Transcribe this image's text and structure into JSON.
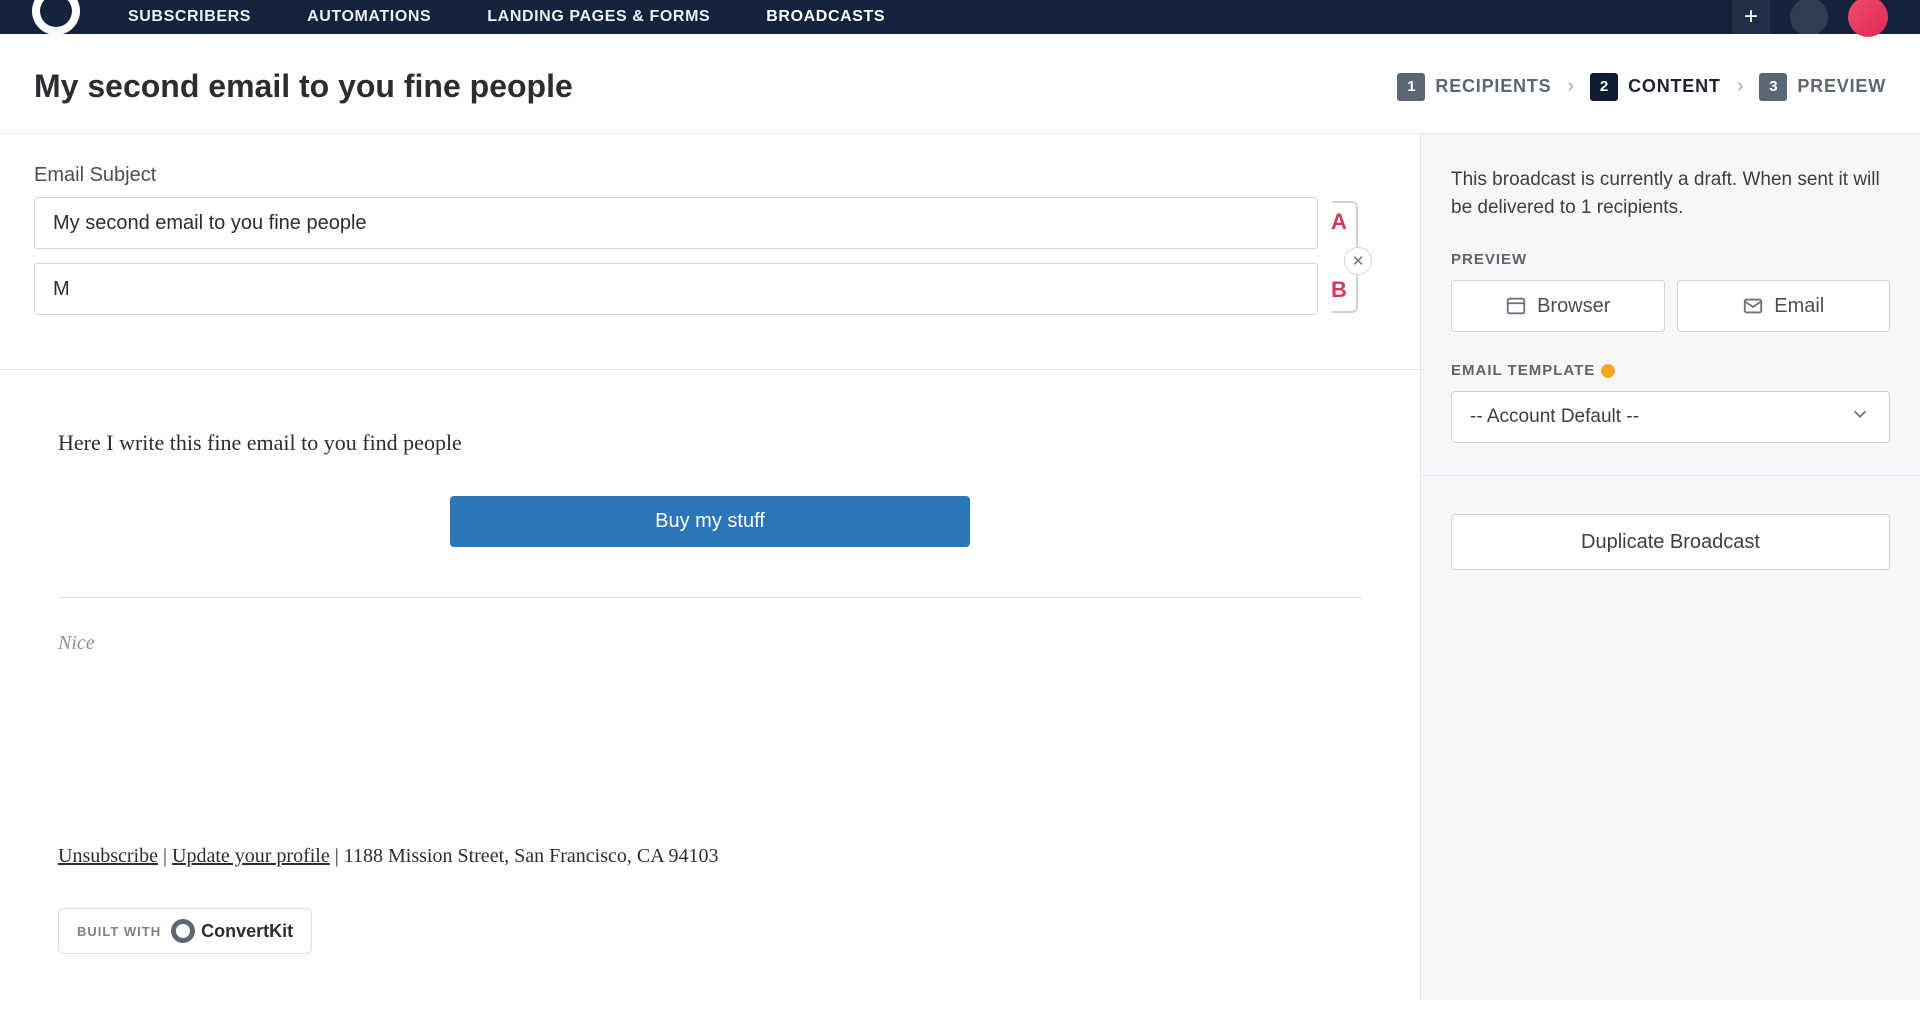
{
  "nav": {
    "links": [
      "SUBSCRIBERS",
      "AUTOMATIONS",
      "LANDING PAGES & FORMS",
      "BROADCASTS"
    ],
    "active_index": 3
  },
  "header": {
    "title": "My second email to you fine people",
    "steps": [
      {
        "num": "1",
        "label": "RECIPIENTS"
      },
      {
        "num": "2",
        "label": "CONTENT"
      },
      {
        "num": "3",
        "label": "PREVIEW"
      }
    ],
    "active_step_index": 1
  },
  "subject": {
    "label": "Email Subject",
    "a_value": "My second email to you fine people",
    "b_value": "M",
    "a_tag": "A",
    "b_tag": "B"
  },
  "email_body": {
    "line1": "Here I write this fine email to you find people",
    "cta": "Buy my stuff",
    "signature": "Nice",
    "unsubscribe": "Unsubscribe",
    "update": "Update your profile",
    "address": "1188 Mission Street, San Francisco, CA 94103",
    "sep": " | ",
    "builtwith_label": "BUILT WITH",
    "brand": "ConvertKit"
  },
  "sidebar": {
    "draft_notice": "This broadcast is currently a draft. When sent it will be delivered to 1 recipients.",
    "preview_heading": "PREVIEW",
    "browser_btn": "Browser",
    "email_btn": "Email",
    "template_heading": "EMAIL TEMPLATE",
    "template_value": "-- Account Default --",
    "duplicate_btn": "Duplicate Broadcast"
  }
}
